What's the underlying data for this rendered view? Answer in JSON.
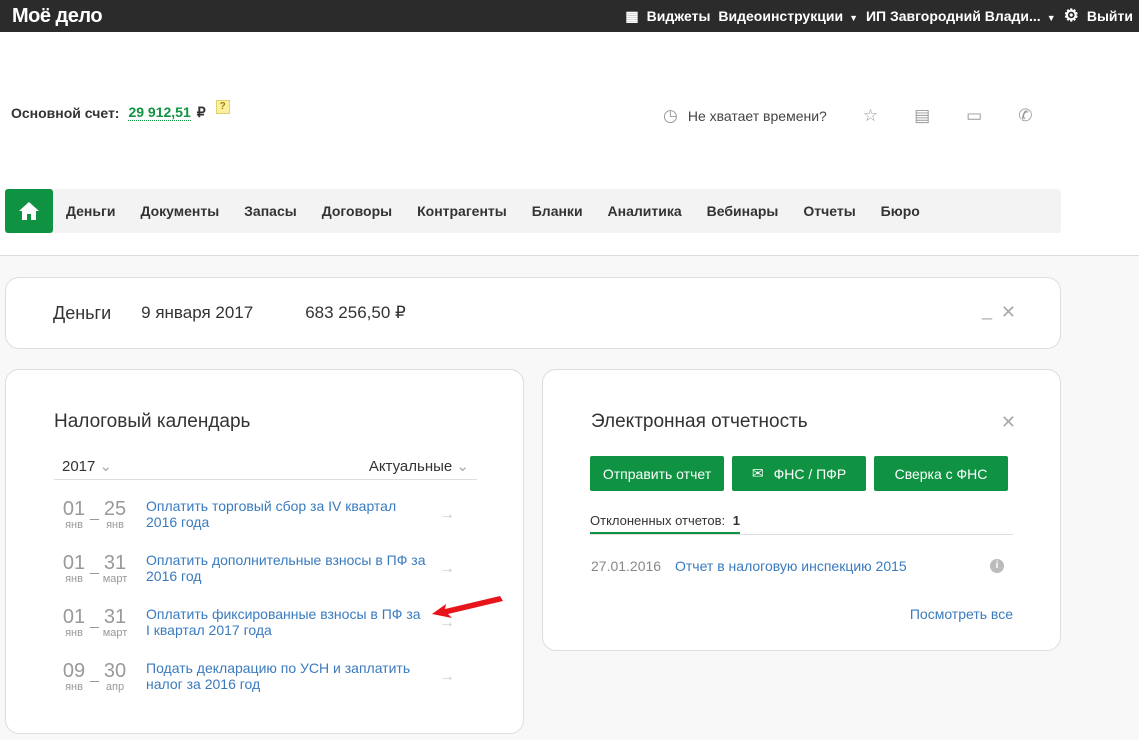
{
  "topbar": {
    "logo": "Моё дело",
    "widgets": "Виджеты",
    "video": "Видеоинструкции",
    "user": "ИП Завгородний Влади...",
    "logout": "Выйти"
  },
  "account": {
    "label": "Основной счет:",
    "amount": "29 912,51",
    "currency": "₽",
    "help": "?"
  },
  "tools": {
    "time_label": "Не хватает времени?"
  },
  "nav": {
    "items": [
      "Деньги",
      "Документы",
      "Запасы",
      "Договоры",
      "Контрагенты",
      "Бланки",
      "Аналитика",
      "Вебинары",
      "Отчеты",
      "Бюро"
    ]
  },
  "money": {
    "title": "Деньги",
    "date": "9 января 2017",
    "sum": "683 256,50 ₽"
  },
  "tax": {
    "title": "Налоговый календарь",
    "year": "2017",
    "filter": "Актуальные",
    "rows": [
      {
        "d1": "01",
        "m1": "янв",
        "d2": "25",
        "m2": "янв",
        "text": "Оплатить торговый сбор за IV квартал 2016 года"
      },
      {
        "d1": "01",
        "m1": "янв",
        "d2": "31",
        "m2": "март",
        "text": "Оплатить дополнительные взносы в ПФ за 2016 год"
      },
      {
        "d1": "01",
        "m1": "янв",
        "d2": "31",
        "m2": "март",
        "text": "Оплатить фиксированные взносы в ПФ за I квартал 2017 года"
      },
      {
        "d1": "09",
        "m1": "янв",
        "d2": "30",
        "m2": "апр",
        "text": "Подать декларацию по УСН и заплатить налог за 2016 год"
      }
    ]
  },
  "eo": {
    "title": "Электронная отчетность",
    "send": "Отправить отчет",
    "fns_pfr": "ФНС / ПФР",
    "sverka": "Сверка с ФНС",
    "rejected_label": "Отклоненных отчетов:",
    "rejected_count": "1",
    "report_date": "27.01.2016",
    "report_name": "Отчет в налоговую инспекцию 2015",
    "view_all": "Посмотреть все"
  }
}
